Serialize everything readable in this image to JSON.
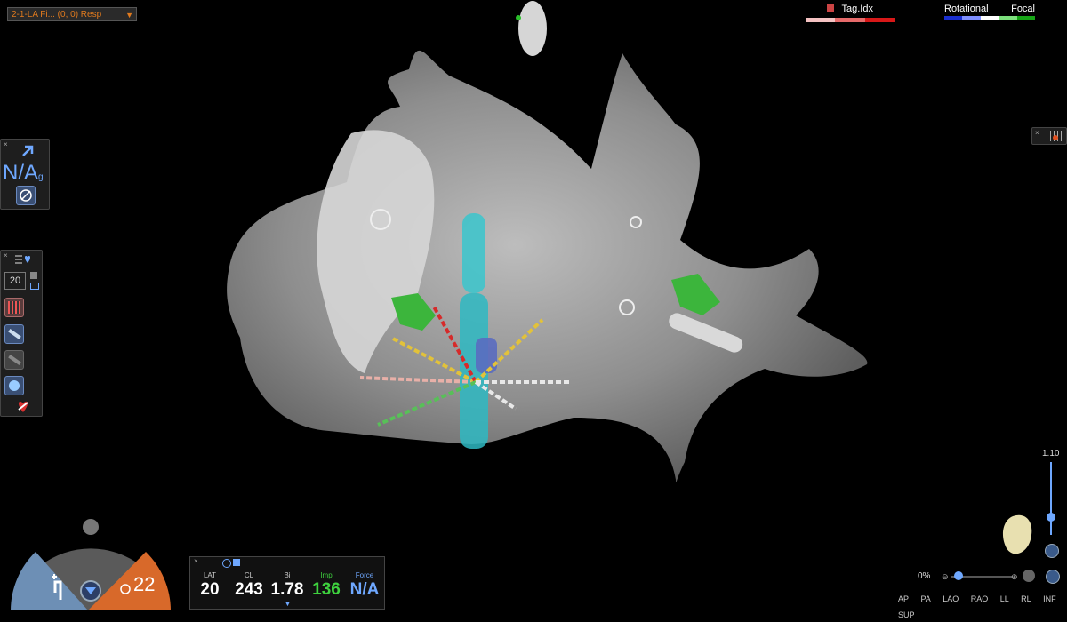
{
  "map_selector": {
    "value": "2-1-LA Fi...  (0, 0) Resp"
  },
  "tag_index": {
    "label": "Tag.Idx",
    "colors": [
      "#f4c2c2",
      "#e66a6a",
      "#d81818"
    ]
  },
  "rotational_focal": {
    "left_label": "Rotational",
    "right_label": "Focal",
    "colors": [
      "#1a2fd0",
      "#7f8fff",
      "#ffffff",
      "#7de07d",
      "#16a516"
    ]
  },
  "left_panel_top": {
    "close": "×",
    "na_label": "N/A",
    "subscript": "g"
  },
  "left_panel_tools": {
    "close": "×",
    "count": "20"
  },
  "gauge": {
    "value": "22"
  },
  "measurements": {
    "close": "×",
    "items": [
      {
        "label": "LAT",
        "value": "20",
        "color": "#ffffff"
      },
      {
        "label": "CL",
        "value": "243",
        "color": "#ffffff"
      },
      {
        "label": "Bi",
        "value": "1.78",
        "color": "#ffffff"
      },
      {
        "label": "Imp",
        "value": "136",
        "color": "#3ed13e"
      },
      {
        "label": "Force",
        "value": "N/A",
        "color": "#6fa8ff"
      }
    ]
  },
  "zoom": {
    "scale": "1.10",
    "percent": "0%"
  },
  "view_buttons": [
    "AP",
    "PA",
    "LAO",
    "RAO",
    "LL",
    "RL",
    "INF",
    "SUP"
  ],
  "colors": {
    "accent": "#e07a1e",
    "tool_blue": "#3a4f74"
  }
}
